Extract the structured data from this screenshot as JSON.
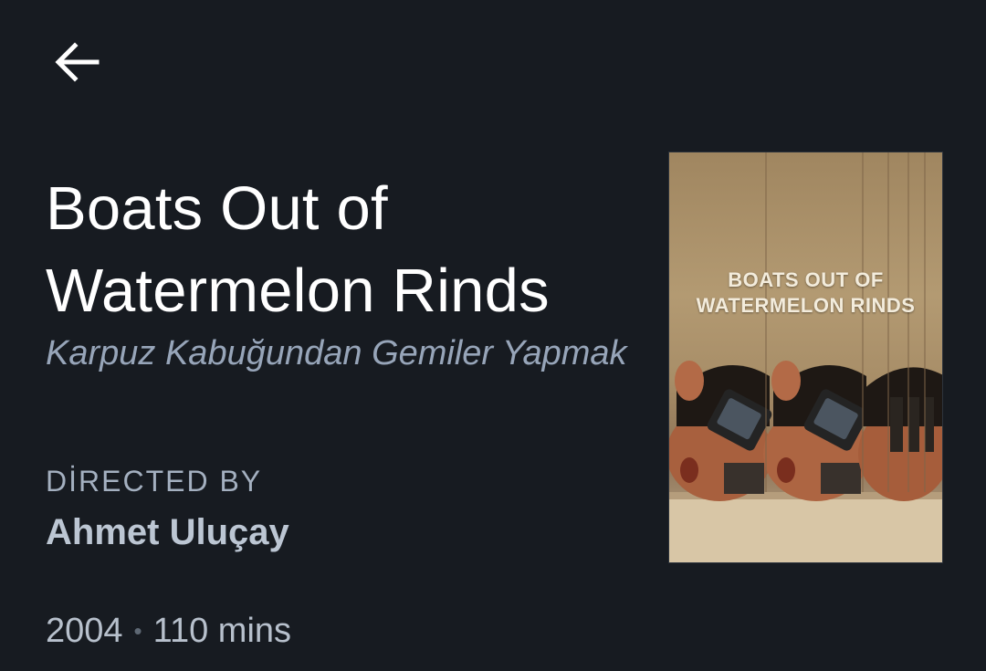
{
  "header": {
    "back_icon": "arrow-left-icon"
  },
  "film": {
    "title": "Boats Out of Watermelon Rinds",
    "original_title": "Karpuz Kabuğundan Gemiler Yapmak",
    "directed_by_label": "DİRECTED BY",
    "director": "Ahmet Uluçay",
    "year": "2004",
    "separator": "•",
    "runtime": "110 mins",
    "poster": {
      "title": "BOATS OUT OF\nWATERMELON RINDS"
    }
  },
  "colors": {
    "background": "#171b21",
    "title": "#ffffff",
    "original_title": "#97a5b9",
    "label": "#a4b0c0",
    "director": "#bcc6d3",
    "meta": "#b7c0cc"
  }
}
